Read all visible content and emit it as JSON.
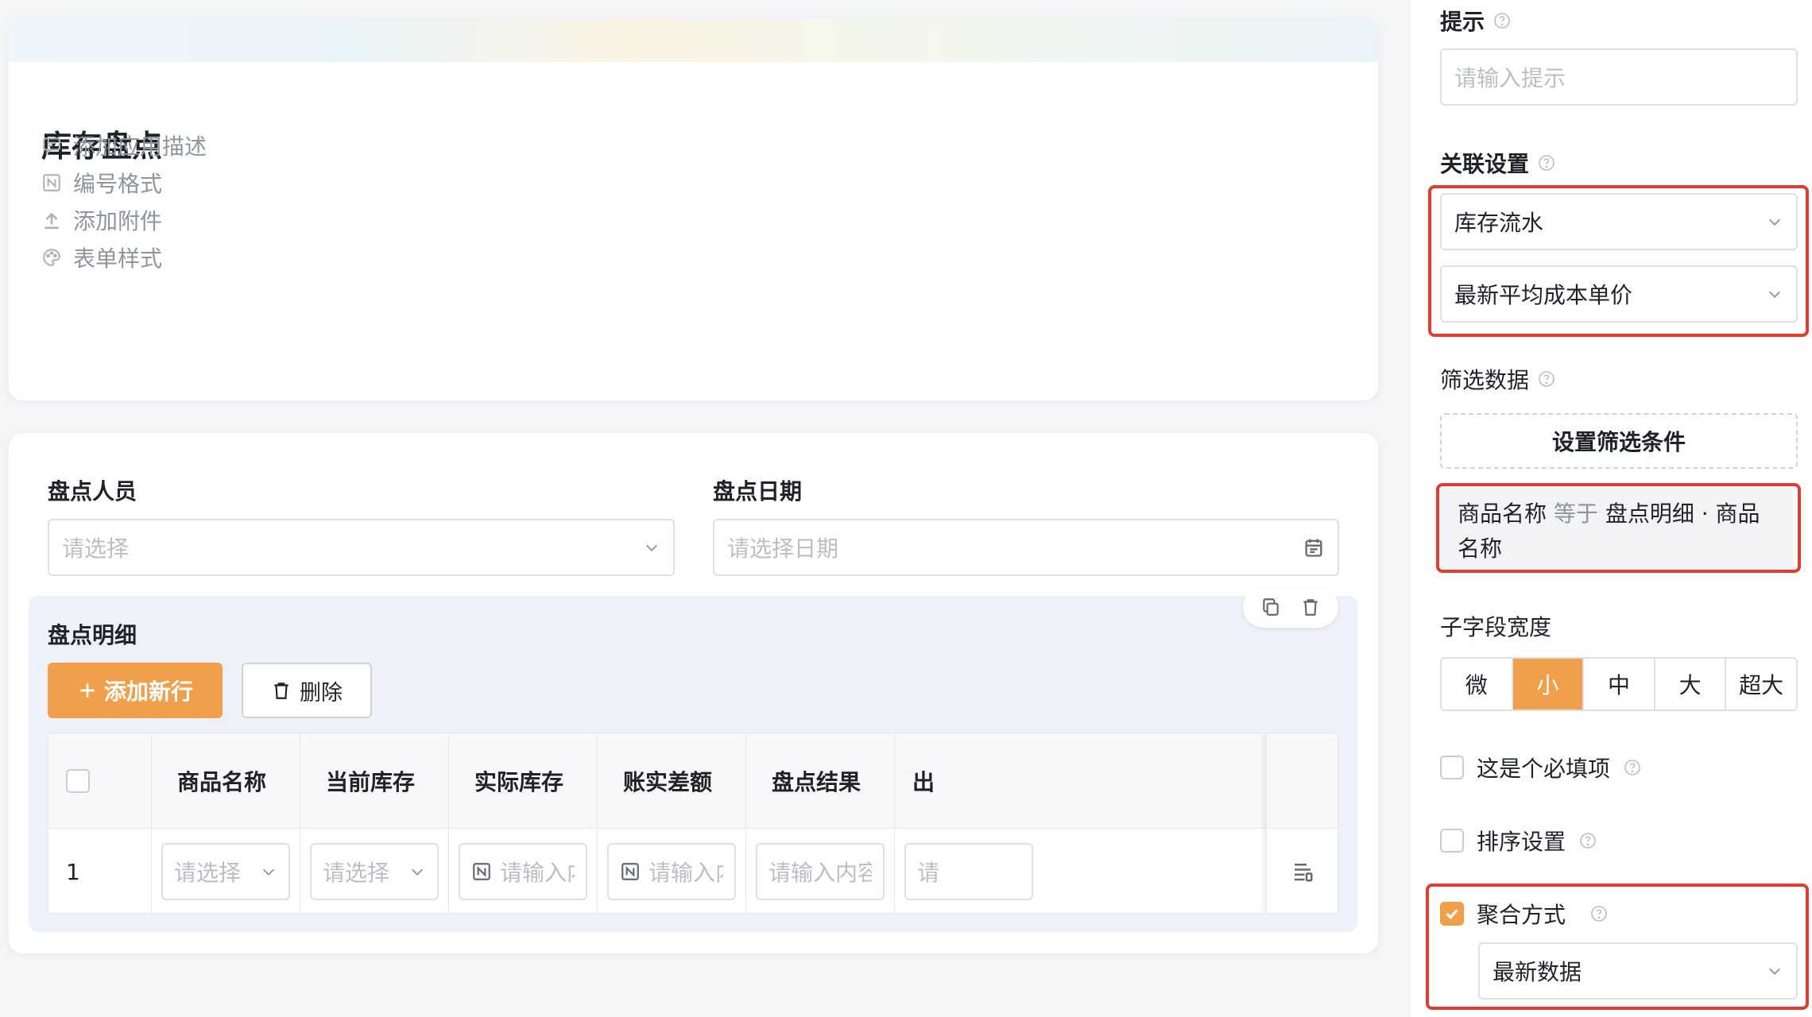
{
  "app": {
    "title": "库存盘点",
    "meta_items": [
      {
        "label": "添加应用描述",
        "icon": "comment-icon"
      },
      {
        "label": "编号格式",
        "icon": "numbering-icon"
      },
      {
        "label": "添加附件",
        "icon": "upload-icon"
      },
      {
        "label": "表单样式",
        "icon": "palette-icon"
      }
    ]
  },
  "form": {
    "fields": [
      {
        "label": "盘点人员",
        "placeholder": "请选择"
      },
      {
        "label": "盘点日期",
        "placeholder": "请选择日期"
      }
    ],
    "subtable": {
      "title": "盘点明细",
      "add_label": "添加新行",
      "delete_label": "删除",
      "columns": [
        "商品名称",
        "当前库存",
        "实际库存",
        "账实差额",
        "盘点结果",
        "出"
      ],
      "row_number": "1",
      "row_cells": [
        "请选择",
        "请选择",
        "请输入内容",
        "请输入内容",
        "请输入内容",
        "请"
      ]
    }
  },
  "panel": {
    "hint_label": "提示",
    "hint_placeholder": "请输入提示",
    "relation_label": "关联设置",
    "relation_form": "库存流水",
    "relation_field": "最新平均成本单价",
    "filter_label": "筛选数据",
    "filter_button": "设置筛选条件",
    "condition": {
      "field": "商品名称",
      "operator": "等于",
      "value": "盘点明细 · 商品名称"
    },
    "width_label": "子字段宽度",
    "width_options": [
      "微",
      "小",
      "中",
      "大",
      "超大"
    ],
    "width_selected": "小",
    "required_label": "这是个必填项",
    "sort_label": "排序设置",
    "aggregate_label": "聚合方式",
    "aggregate_checked": true,
    "aggregate_value": "最新数据"
  },
  "colors": {
    "accent": "#f0a04b",
    "highlight": "#e53b2e",
    "subtable_bg": "#eef1fa"
  }
}
